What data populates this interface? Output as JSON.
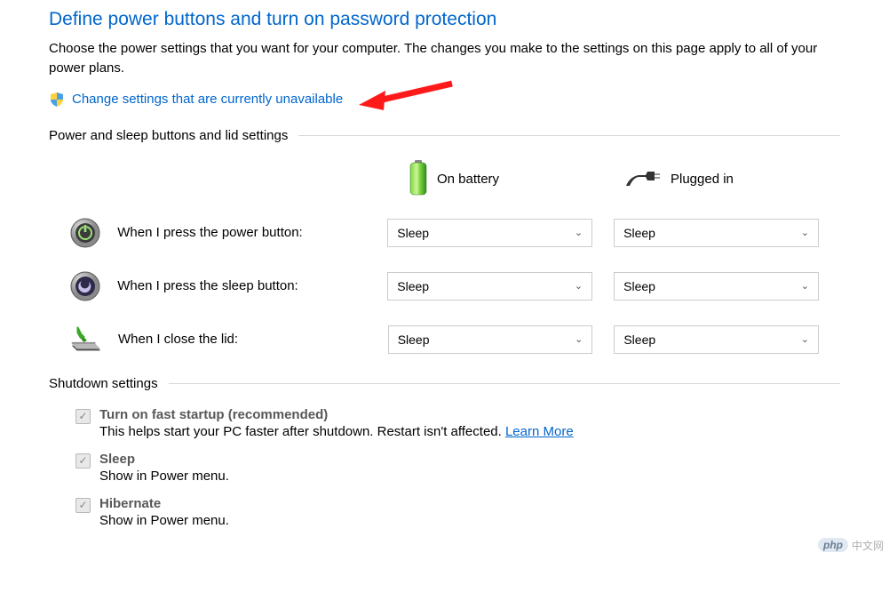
{
  "title": "Define power buttons and turn on password protection",
  "description": "Choose the power settings that you want for your computer. The changes you make to the settings on this page apply to all of your power plans.",
  "change_link": "Change settings that are currently unavailable",
  "sections": {
    "power_sleep": {
      "label": "Power and sleep buttons and lid settings",
      "columns": {
        "battery": "On battery",
        "plugged": "Plugged in"
      },
      "rows": [
        {
          "label": "When I press the power button:",
          "battery": "Sleep",
          "plugged": "Sleep"
        },
        {
          "label": "When I press the sleep button:",
          "battery": "Sleep",
          "plugged": "Sleep"
        },
        {
          "label": "When I close the lid:",
          "battery": "Sleep",
          "plugged": "Sleep"
        }
      ]
    },
    "shutdown": {
      "label": "Shutdown settings",
      "items": [
        {
          "checked": true,
          "title": "Turn on fast startup (recommended)",
          "desc": "This helps start your PC faster after shutdown. Restart isn't affected. ",
          "learn_more": "Learn More"
        },
        {
          "checked": true,
          "title": "Sleep",
          "desc": "Show in Power menu."
        },
        {
          "checked": true,
          "title": "Hibernate",
          "desc": "Show in Power menu."
        }
      ]
    }
  },
  "watermark": {
    "badge": "php",
    "text": "中文网"
  }
}
